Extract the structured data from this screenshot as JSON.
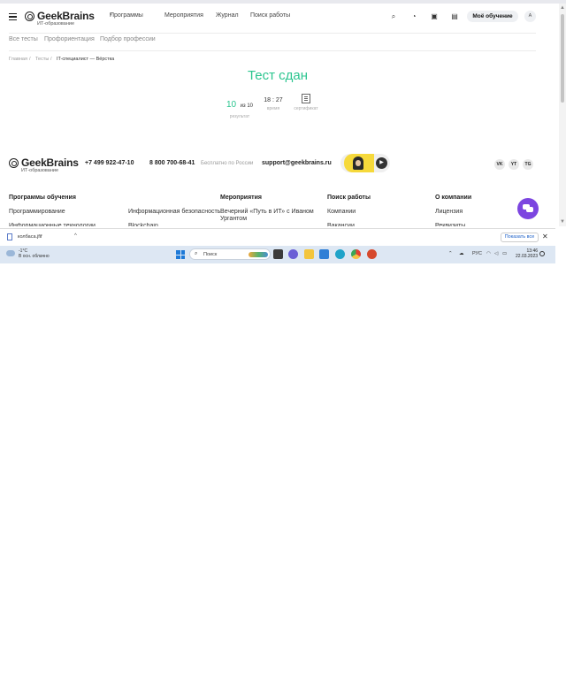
{
  "header": {
    "logo": {
      "name": "GeekBrains",
      "sub": "ИТ-образование"
    },
    "nav": [
      {
        "label": "Программы"
      },
      {
        "label": "Мероприятия"
      },
      {
        "label": "Журнал"
      },
      {
        "label": "Поиск работы"
      }
    ],
    "nav_caret": "▾",
    "icons": [
      "search-icon",
      "bell-icon",
      "calendar-icon",
      "messages-icon"
    ],
    "my_learning": "Моё обучение",
    "avatar_initial": "А"
  },
  "subnav": [
    "Все тесты",
    "Профориентация",
    "Подбор профессии"
  ],
  "breadcrumbs": {
    "items": [
      "Главная",
      "Тесты"
    ],
    "separator": "/",
    "current": "IT-специалист — Вёрстка"
  },
  "result": {
    "title": "Тест сдан",
    "score": "10",
    "score_of": "из 10",
    "score_label": "результат",
    "time": "18 : 27",
    "time_label": "время",
    "cert_label": "сертификат"
  },
  "footer": {
    "logo": {
      "name": "GeekBrains",
      "sub": "ИТ-образование"
    },
    "phone1": "+7 499 922-47-10",
    "phone2": "8 800 700-68-41",
    "phone2_note": "Бесплатно по России",
    "email": "support@geekbrains.ru",
    "socials": [
      "VK",
      "YT",
      "TG"
    ],
    "columns": {
      "programs": {
        "heading": "Программы обучения",
        "items": [
          "Программирование",
          "Информационная безопасность",
          "Информационные технологии",
          "Blockchain"
        ]
      },
      "events": {
        "heading": "Мероприятия",
        "items": [
          "Вечерний «Путь в ИТ» с Иваном",
          "Ургантом"
        ]
      },
      "jobs": {
        "heading": "Поиск работы",
        "items": [
          "Компании",
          "Вакансии"
        ]
      },
      "company": {
        "heading": "О компании",
        "items": [
          "Лицензия",
          "Реквизиты"
        ]
      }
    }
  },
  "download_bar": {
    "file_name": "колбаса.jfif",
    "caret": "^",
    "show_all": "Показать все",
    "close": "✕"
  },
  "taskbar": {
    "weather_temp": "-1°C",
    "weather_text": "В осн. облачно",
    "search_placeholder": "Поиск",
    "tray_lang": "РУС",
    "time": "13:46",
    "date": "22.03.2023"
  },
  "colors": {
    "accent_green": "#2bc58f",
    "chat_purple": "#7c45e0",
    "download_link": "#1a5ec7"
  }
}
